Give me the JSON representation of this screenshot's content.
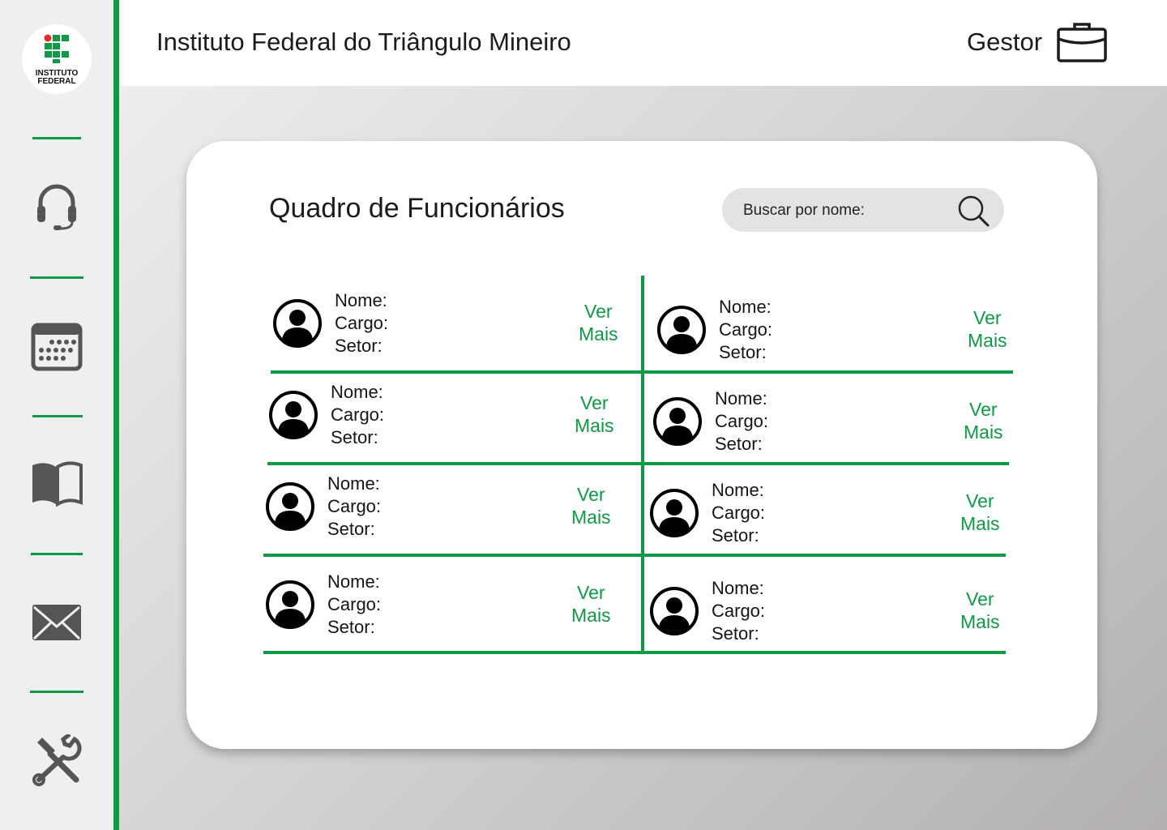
{
  "app": {
    "logo_line1": "INSTITUTO",
    "logo_line2": "FEDERAL",
    "institution_title": "Instituto Federal do Triângulo Mineiro",
    "role_label": "Gestor"
  },
  "sidebar": {
    "items": [
      {
        "icon": "headset-icon"
      },
      {
        "icon": "calendar-icon"
      },
      {
        "icon": "book-icon"
      },
      {
        "icon": "mail-icon"
      },
      {
        "icon": "tools-icon"
      }
    ]
  },
  "board": {
    "title": "Quadro de Funcionários",
    "search_placeholder": "Buscar por nome:",
    "employees": [
      {
        "name_label": "Nome:",
        "role_label": "Cargo:",
        "sector_label": "Setor:",
        "more_line1": "Ver",
        "more_line2": "Mais"
      },
      {
        "name_label": "Nome:",
        "role_label": "Cargo:",
        "sector_label": "Setor:",
        "more_line1": "Ver",
        "more_line2": "Mais"
      },
      {
        "name_label": "Nome:",
        "role_label": "Cargo:",
        "sector_label": "Setor:",
        "more_line1": "Ver",
        "more_line2": "Mais"
      },
      {
        "name_label": "Nome:",
        "role_label": "Cargo:",
        "sector_label": "Setor:",
        "more_line1": "Ver",
        "more_line2": "Mais"
      },
      {
        "name_label": "Nome:",
        "role_label": "Cargo:",
        "sector_label": "Setor:",
        "more_line1": "Ver",
        "more_line2": "Mais"
      },
      {
        "name_label": "Nome:",
        "role_label": "Cargo:",
        "sector_label": "Setor:",
        "more_line1": "Ver",
        "more_line2": "Mais"
      },
      {
        "name_label": "Nome:",
        "role_label": "Cargo:",
        "sector_label": "Setor:",
        "more_line1": "Ver",
        "more_line2": "Mais"
      },
      {
        "name_label": "Nome:",
        "role_label": "Cargo:",
        "sector_label": "Setor:",
        "more_line1": "Ver",
        "more_line2": "Mais"
      }
    ]
  },
  "colors": {
    "accent_green": "#0e9a44",
    "logo_red": "#e32d2d",
    "sidebar_bg": "#efefef",
    "search_bg": "#e3e3e3"
  }
}
